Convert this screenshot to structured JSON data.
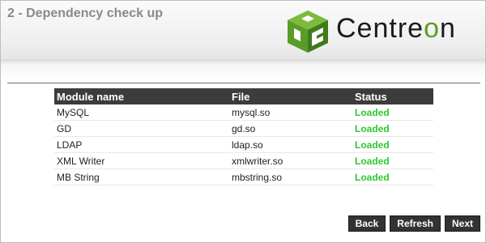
{
  "header": {
    "step_title": "2 - Dependency check up",
    "logo_text_prefix": "Centre",
    "logo_text_o": "o",
    "logo_text_suffix": "n",
    "brand_color": "#5a9c2a"
  },
  "table": {
    "headers": [
      "Module name",
      "File",
      "Status"
    ],
    "rows": [
      {
        "module": "MySQL",
        "file": "mysql.so",
        "status": "Loaded"
      },
      {
        "module": "GD",
        "file": "gd.so",
        "status": "Loaded"
      },
      {
        "module": "LDAP",
        "file": "ldap.so",
        "status": "Loaded"
      },
      {
        "module": "XML Writer",
        "file": "xmlwriter.so",
        "status": "Loaded"
      },
      {
        "module": "MB String",
        "file": "mbstring.so",
        "status": "Loaded"
      }
    ],
    "status_color": "#2ec72e"
  },
  "buttons": {
    "back": "Back",
    "refresh": "Refresh",
    "next": "Next"
  }
}
